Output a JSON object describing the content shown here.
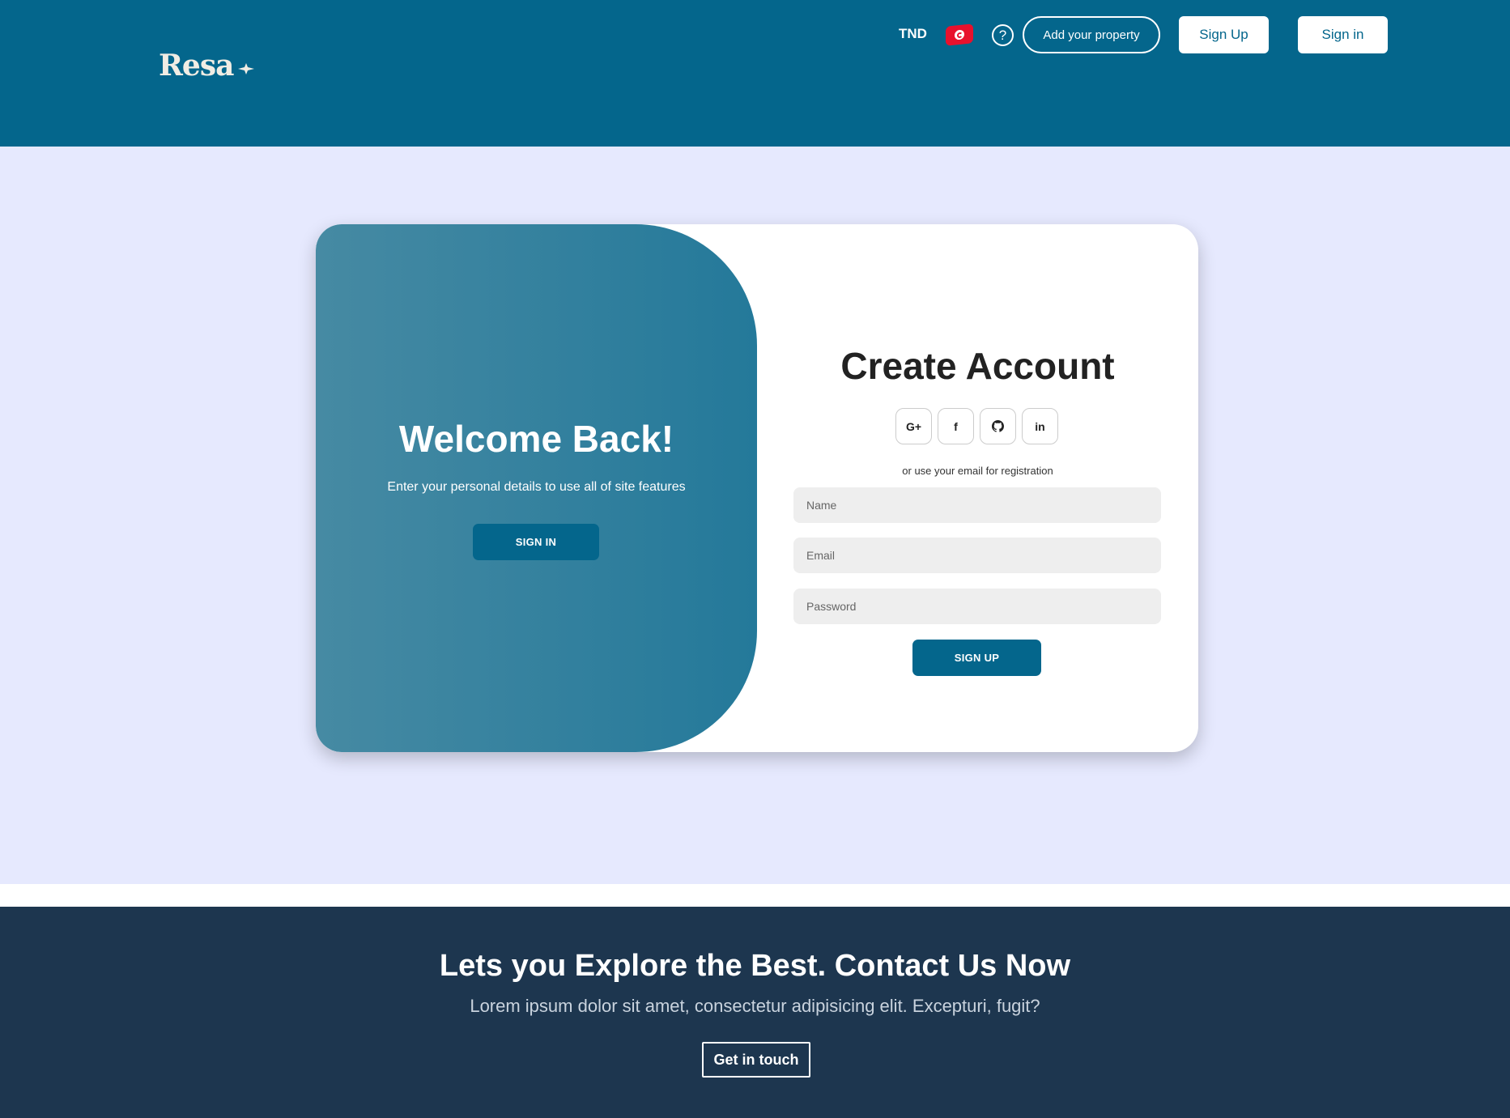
{
  "header": {
    "logo_text": "Resa",
    "currency": "TND",
    "help_symbol": "?",
    "add_property_label": "Add your property",
    "sign_up_label": "Sign Up",
    "sign_in_label": "Sign in",
    "background_color": "#04668c"
  },
  "welcome": {
    "title": "Welcome Back!",
    "subtitle": "Enter your personal details to use all of site features",
    "button_label": "SIGN IN"
  },
  "create_account": {
    "title": "Create Account",
    "socials": [
      {
        "label": "G+",
        "icon": "google-plus-icon"
      },
      {
        "label": "f",
        "icon": "facebook-icon"
      },
      {
        "label": "",
        "icon": "github-icon"
      },
      {
        "label": "in",
        "icon": "linkedin-icon"
      }
    ],
    "or_text": "or use your email for registration",
    "fields": {
      "name_placeholder": "Name",
      "email_placeholder": "Email",
      "password_placeholder": "Password"
    },
    "button_label": "SIGN UP"
  },
  "footer": {
    "title": "Lets you Explore the Best. Contact Us Now",
    "subtitle": "Lorem ipsum dolor sit amet, consectetur adipisicing elit. Excepturi, fugit?",
    "button_label": "Get in touch",
    "background_color": "#1d364f"
  },
  "colors": {
    "page_background": "#e6e9fe",
    "accent": "#04668c",
    "panel_gradient_start": "#468aa3",
    "panel_gradient_end": "#24799a"
  }
}
